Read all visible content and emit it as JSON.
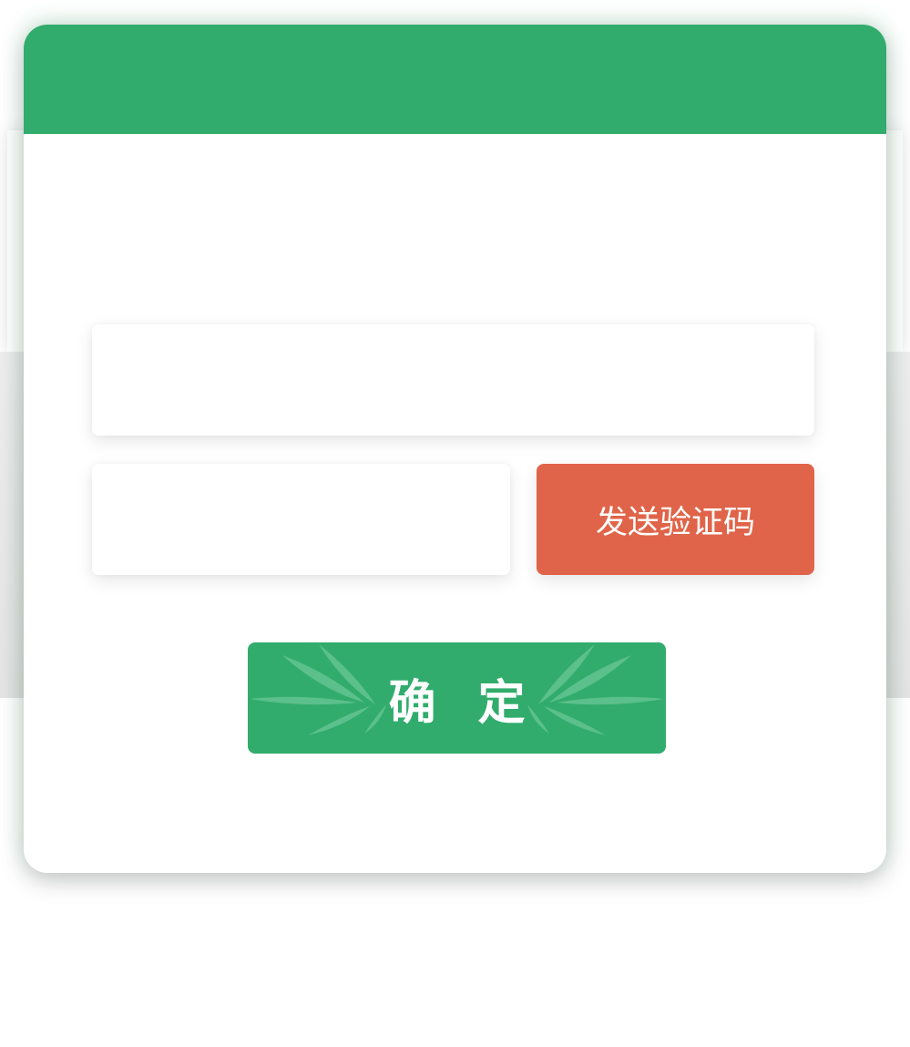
{
  "dialog": {
    "phone_input": {
      "value": "",
      "placeholder": ""
    },
    "code_input": {
      "value": "",
      "placeholder": ""
    },
    "send_code_label": "发送验证码",
    "confirm_label": "确 定"
  },
  "colors": {
    "primary_green": "#31ac6c",
    "send_button": "#e06449",
    "background": "#ffffff"
  },
  "icons": {
    "confirm_decoration": "bamboo-leaves-icon"
  }
}
